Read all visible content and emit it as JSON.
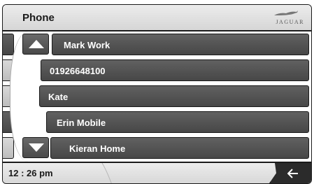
{
  "header": {
    "title": "Phone",
    "brand_text": "JAGUAR"
  },
  "contacts": [
    {
      "label": "Mark Work"
    },
    {
      "label": "01926648100"
    },
    {
      "label": "Kate"
    },
    {
      "label": "Erin Mobile"
    },
    {
      "label": "Kieran Home"
    }
  ],
  "controls": {
    "scroll_up_icon": "triangle-up",
    "scroll_down_icon": "triangle-down",
    "back_icon": "arrow-left"
  },
  "footer": {
    "time": "12 : 26 pm"
  },
  "colors": {
    "row": "#545454",
    "header": "#e2e2e2",
    "back_button": "#2b2b2b"
  }
}
